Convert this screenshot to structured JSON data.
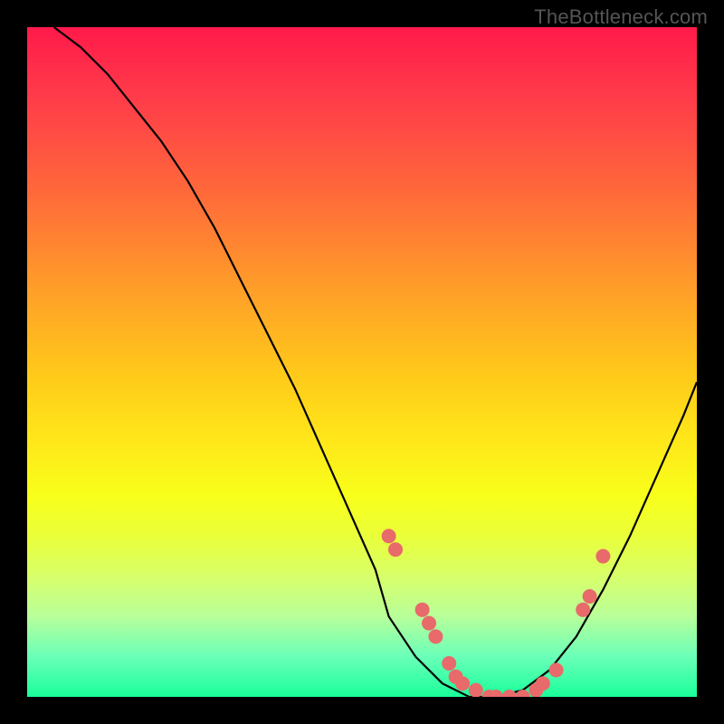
{
  "watermark": "TheBottleneck.com",
  "chart_data": {
    "type": "line",
    "title": "",
    "xlabel": "",
    "ylabel": "",
    "xlim": [
      0,
      100
    ],
    "ylim": [
      0,
      100
    ],
    "grid": false,
    "legend": false,
    "series": [
      {
        "name": "curve",
        "x": [
          4,
          8,
          12,
          16,
          20,
          24,
          28,
          32,
          36,
          40,
          44,
          48,
          52,
          54,
          58,
          62,
          66,
          70,
          74,
          78,
          82,
          86,
          90,
          94,
          98,
          100
        ],
        "y": [
          100,
          97,
          93,
          88,
          83,
          77,
          70,
          62,
          54,
          46,
          37,
          28,
          19,
          12,
          6,
          2,
          0,
          0,
          1,
          4,
          9,
          16,
          24,
          33,
          42,
          47
        ]
      }
    ],
    "markers": [
      {
        "x": 54,
        "y": 24
      },
      {
        "x": 55,
        "y": 22
      },
      {
        "x": 59,
        "y": 13
      },
      {
        "x": 60,
        "y": 11
      },
      {
        "x": 61,
        "y": 9
      },
      {
        "x": 63,
        "y": 5
      },
      {
        "x": 64,
        "y": 3
      },
      {
        "x": 65,
        "y": 2
      },
      {
        "x": 67,
        "y": 1
      },
      {
        "x": 69,
        "y": 0
      },
      {
        "x": 70,
        "y": 0
      },
      {
        "x": 72,
        "y": 0
      },
      {
        "x": 74,
        "y": 0
      },
      {
        "x": 76,
        "y": 1
      },
      {
        "x": 77,
        "y": 2
      },
      {
        "x": 79,
        "y": 4
      },
      {
        "x": 83,
        "y": 13
      },
      {
        "x": 84,
        "y": 15
      },
      {
        "x": 86,
        "y": 21
      }
    ],
    "colors": {
      "gradient_top": "#ff1a4a",
      "gradient_bottom": "#1aff9a",
      "curve": "#000000",
      "marker": "#e86a6a",
      "frame": "#000000"
    }
  }
}
